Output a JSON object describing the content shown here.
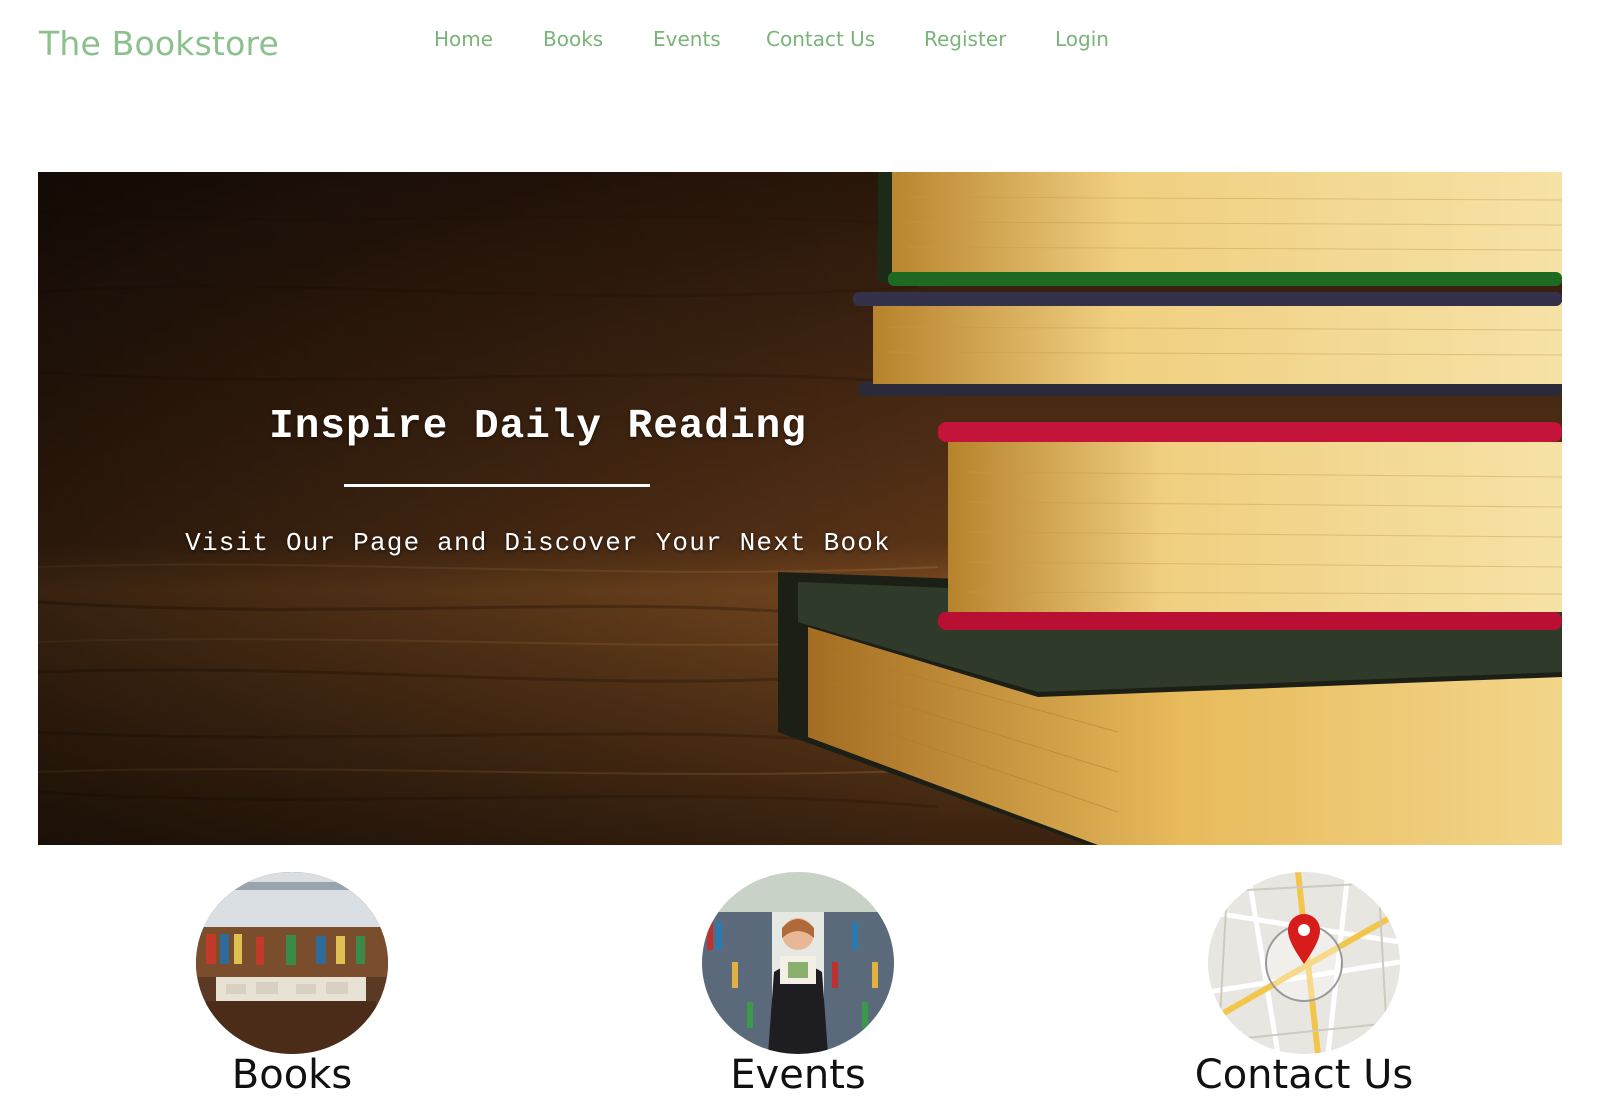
{
  "header": {
    "brand": "The Bookstore",
    "nav": [
      "Home",
      "Books",
      "Events",
      "Contact Us",
      "Register",
      "Login"
    ]
  },
  "hero": {
    "title": "Inspire Daily Reading",
    "subtitle": "Visit Our Page and Discover Your Next Book"
  },
  "features": [
    {
      "label": "Books"
    },
    {
      "label": "Events"
    },
    {
      "label": "Contact Us"
    }
  ],
  "colors": {
    "brand": "#8cc08c",
    "nav": "#79b479",
    "hero_text": "#ffffff",
    "map_pin": "#d81b1b"
  },
  "icons": {
    "contact_image": "map-pin-icon"
  }
}
